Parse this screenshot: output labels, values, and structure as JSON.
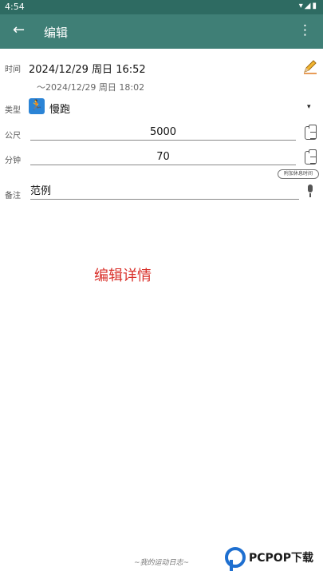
{
  "status_bar": {
    "time": "4:54",
    "indicators": "▾◢▮"
  },
  "app_bar": {
    "back_icon": "arrow-left",
    "title": "编辑",
    "more_icon": "more-vertical"
  },
  "form": {
    "time": {
      "label": "时间",
      "start": "2024/12/29 周日 16:52",
      "end": "～2024/12/29 周日 18:02",
      "edit_icon": "pencil"
    },
    "type": {
      "label": "类型",
      "icon": "running-person",
      "value": "慢跑",
      "dropdown_icon": "▾"
    },
    "distance": {
      "label": "公尺",
      "value": "5000",
      "action_icon": "clipboard"
    },
    "duration": {
      "label": "分钟",
      "value": "70",
      "action_icon": "clipboard",
      "rest_button": "附加休息时间"
    },
    "note": {
      "label": "备注",
      "value": "范例",
      "mic_icon": "microphone"
    }
  },
  "overlay_caption": "编辑详情",
  "footer": "~我的运动日志~",
  "watermark": {
    "text": "PCPOP下载"
  },
  "colors": {
    "app_bar": "#3f7f76",
    "status_bar": "#2e6b62",
    "type_icon": "#2b84d6",
    "overlay_text": "#d9302a",
    "watermark_blue": "#1e6fd0"
  }
}
